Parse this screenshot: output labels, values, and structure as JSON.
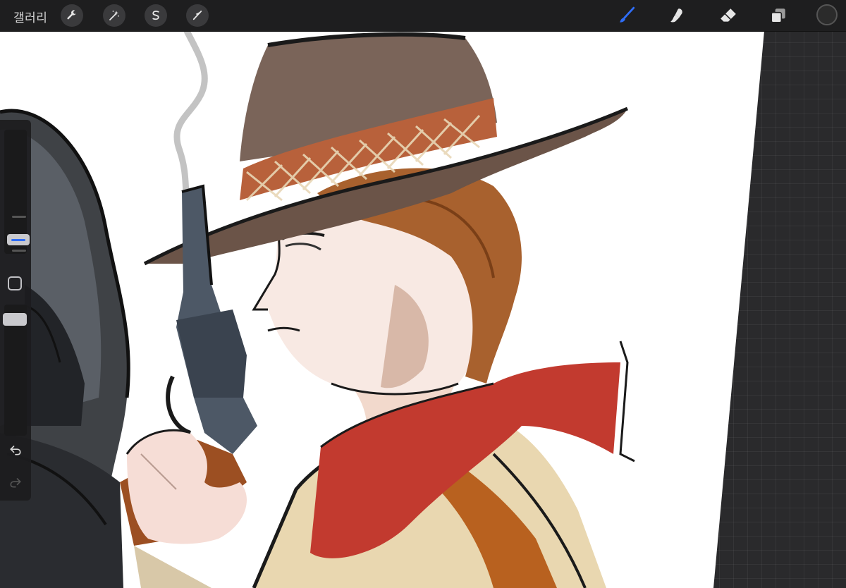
{
  "topbar": {
    "gallery_label": "갤러리",
    "left_tools": [
      {
        "name": "actions",
        "icon": "wrench-icon"
      },
      {
        "name": "adjustments",
        "icon": "magic-wand-icon"
      },
      {
        "name": "selection",
        "icon": "selection-s-icon"
      },
      {
        "name": "transform",
        "icon": "arrow-cursor-icon"
      }
    ],
    "right_tools": [
      {
        "name": "brush",
        "icon": "brush-icon",
        "active": true
      },
      {
        "name": "smudge",
        "icon": "smudge-icon",
        "active": false
      },
      {
        "name": "eraser",
        "icon": "eraser-icon",
        "active": false
      },
      {
        "name": "layers",
        "icon": "layers-icon",
        "active": false
      }
    ],
    "current_color": "#2b2b2b"
  },
  "sidebar": {
    "brush_size_slider": {
      "icon": "size-slider"
    },
    "modify_button": {
      "icon": "square-icon"
    },
    "opacity_slider": {
      "icon": "opacity-slider"
    },
    "undo": {
      "icon": "undo-icon"
    },
    "redo": {
      "icon": "redo-icon",
      "enabled": false
    }
  },
  "colors": {
    "accent": "#2f6df6",
    "toolbar_bg": "#1e1e1f",
    "canvas_bg": "#ffffff",
    "workspace_bg": "#2a2a2c"
  },
  "canvas": {
    "subject": "illustration"
  }
}
